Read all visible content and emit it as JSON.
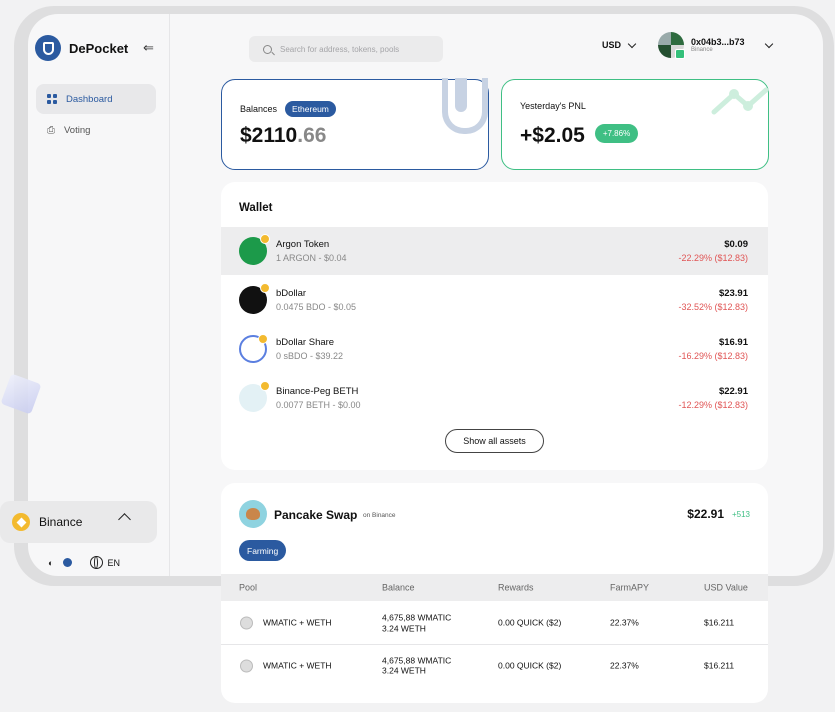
{
  "app": {
    "name": "DePocket"
  },
  "sidebar": {
    "items": [
      {
        "label": "Dashboard",
        "active": true
      },
      {
        "label": "Voting",
        "active": false
      }
    ],
    "chain": "Binance",
    "language": "EN"
  },
  "header": {
    "search_placeholder": "Search for address, tokens, pools",
    "currency": "USD",
    "account": {
      "address": "0x04b3...b73",
      "network": "Binance"
    }
  },
  "balances": {
    "label": "Balances",
    "network": "Ethereum",
    "amount_int": "$2110",
    "amount_dec": ".66"
  },
  "pnl": {
    "label": "Yesterday's PNL",
    "amount": "+$2.05",
    "change": "+7.86%"
  },
  "wallet": {
    "title": "Wallet",
    "tokens": [
      {
        "name": "Argon Token",
        "sub": "1 ARGON - $0.04",
        "value": "$0.09",
        "change": "-22.29% ($12.83)",
        "color": "#1c9a4a"
      },
      {
        "name": "bDollar",
        "sub": "0.0475 BDO - $0.05",
        "value": "$23.91",
        "change": "-32.52% ($12.83)",
        "color": "#111111"
      },
      {
        "name": "bDollar Share",
        "sub": "0 sBDO - $39.22",
        "value": "$16.91",
        "change": "-16.29% ($12.83)",
        "color": "#5b7fe0"
      },
      {
        "name": "Binance-Peg BETH",
        "sub": "0.0077 BETH - $0.00",
        "value": "$22.91",
        "change": "-12.29% ($12.83)",
        "color": "#d9eef3"
      }
    ],
    "show_all_label": "Show all assets"
  },
  "pancake": {
    "title": "Pancake Swap",
    "network": "on Binance",
    "value": "$22.91",
    "change": "+513",
    "tab": "Farming",
    "columns": [
      "Pool",
      "Balance",
      "Rewards",
      "FarmAPY",
      "USD Value"
    ],
    "rows": [
      {
        "pool": "WMATIC + WETH",
        "balance1": "4,675,88 WMATIC",
        "balance2": "3.24 WETH",
        "rewards": "0.00 QUICK ($2)",
        "apy": "22.37%",
        "usd": "$16.211"
      },
      {
        "pool": "WMATIC + WETH",
        "balance1": "4,675,88 WMATIC",
        "balance2": "3.24 WETH",
        "rewards": "0.00 QUICK ($2)",
        "apy": "22.37%",
        "usd": "$16.211"
      }
    ]
  }
}
